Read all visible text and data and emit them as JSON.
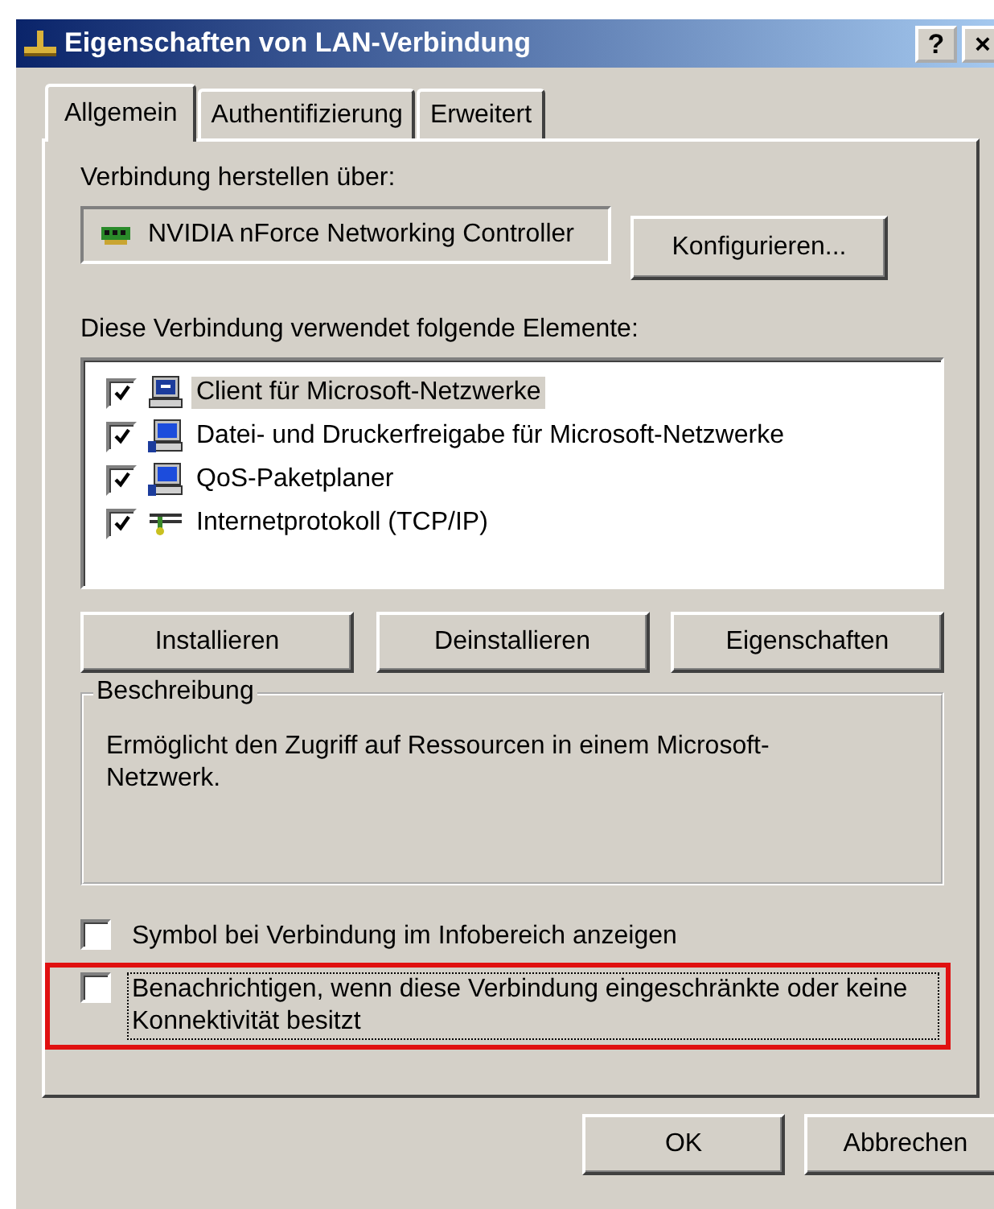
{
  "window": {
    "title": "Eigenschaften von LAN-Verbindung",
    "help_button": "?",
    "close_button": "×"
  },
  "tabs": [
    {
      "label": "Allgemein",
      "selected": true
    },
    {
      "label": "Authentifizierung",
      "selected": false
    },
    {
      "label": "Erweitert",
      "selected": false
    }
  ],
  "connect_using": {
    "label": "Verbindung herstellen über:",
    "adapter": "NVIDIA nForce Networking Controller",
    "configure_button": "Konfigurieren..."
  },
  "components": {
    "label": "Diese Verbindung verwendet folgende Elemente:",
    "items": [
      {
        "label": "Client für Microsoft-Netzwerke",
        "kind": "client",
        "checked": true,
        "selected": true
      },
      {
        "label": "Datei- und Druckerfreigabe für Microsoft-Netzwerke",
        "kind": "service",
        "checked": true,
        "selected": false
      },
      {
        "label": "QoS-Paketplaner",
        "kind": "service",
        "checked": true,
        "selected": false
      },
      {
        "label": "Internetprotokoll (TCP/IP)",
        "kind": "protocol",
        "checked": true,
        "selected": false
      }
    ],
    "buttons": [
      "Installieren",
      "Deinstallieren",
      "Eigenschaften"
    ]
  },
  "description": {
    "legend": "Beschreibung",
    "text": "Ermöglicht den Zugriff auf Ressourcen in einem Microsoft-Netzwerk."
  },
  "options": [
    {
      "label": "Symbol bei Verbindung im Infobereich anzeigen",
      "checked": false,
      "focused": false,
      "highlighted": false
    },
    {
      "label": "Benachrichtigen, wenn diese Verbindung eingeschränkte oder keine Konnektivität besitzt",
      "checked": false,
      "focused": true,
      "highlighted": true
    }
  ],
  "buttons": [
    "OK",
    "Abbrechen"
  ]
}
